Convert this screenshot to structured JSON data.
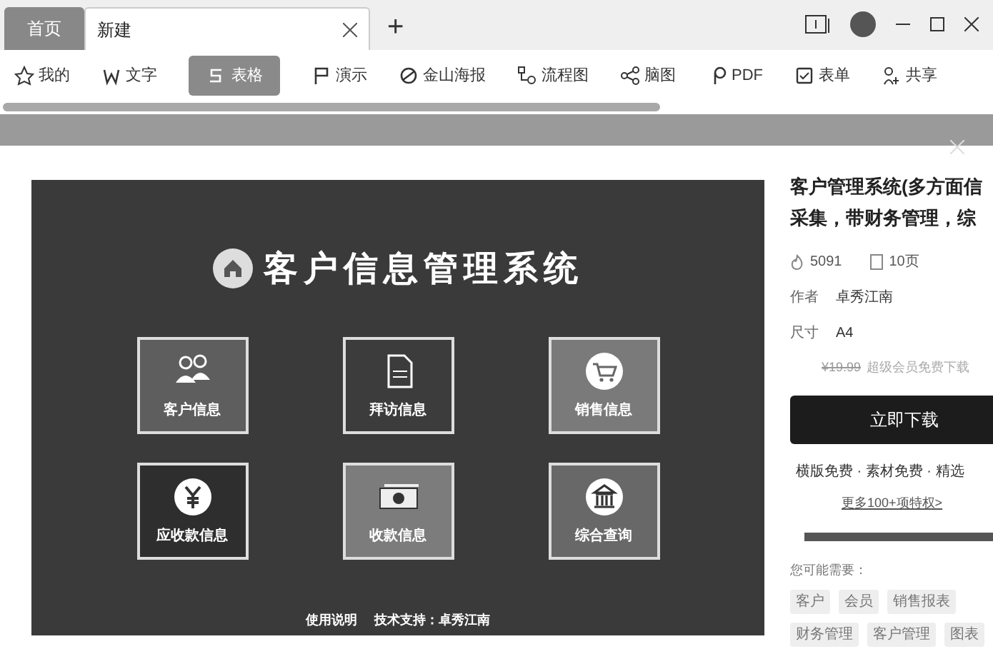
{
  "tabs": [
    {
      "label": "首页",
      "selected": false
    },
    {
      "label": "新建",
      "selected": true
    }
  ],
  "new_tab": "+",
  "toolbar": [
    {
      "label": "我的",
      "selected": false
    },
    {
      "label": "文字",
      "selected": false
    },
    {
      "label": "表格",
      "selected": true
    },
    {
      "label": "演示",
      "selected": false
    },
    {
      "label": "金山海报",
      "selected": false
    },
    {
      "label": "流程图",
      "selected": false
    },
    {
      "label": "脑图",
      "selected": false
    },
    {
      "label": "PDF",
      "selected": false
    },
    {
      "label": "表单",
      "selected": false
    },
    {
      "label": "共享",
      "selected": false
    }
  ],
  "preview": {
    "title": "客户信息管理系统",
    "tiles": [
      "客户信息",
      "拜访信息",
      "销售信息",
      "应收款信息",
      "收款信息",
      "综合查询"
    ],
    "footer": [
      "使用说明",
      "技术支持：卓秀江南"
    ]
  },
  "detail": {
    "title_lines": [
      "客户管理系统(多方面信",
      "采集，带财务管理，综"
    ],
    "likes": "5091",
    "pages": "10页",
    "fields": [
      {
        "label": "作者",
        "value": "卓秀江南"
      },
      {
        "label": "尺寸",
        "value": "A4"
      }
    ],
    "old_price": "¥19.99",
    "price_note": "超级会员免费下载",
    "download": "立即下载",
    "perks": "横版免费 · 素材免费 · 精选",
    "more": "更多100+项特权>",
    "suggest_label": "您可能需要：",
    "tags": [
      [
        "客户",
        "会员",
        "销售报表"
      ],
      [
        "财务管理",
        "客户管理",
        "图表"
      ]
    ]
  }
}
